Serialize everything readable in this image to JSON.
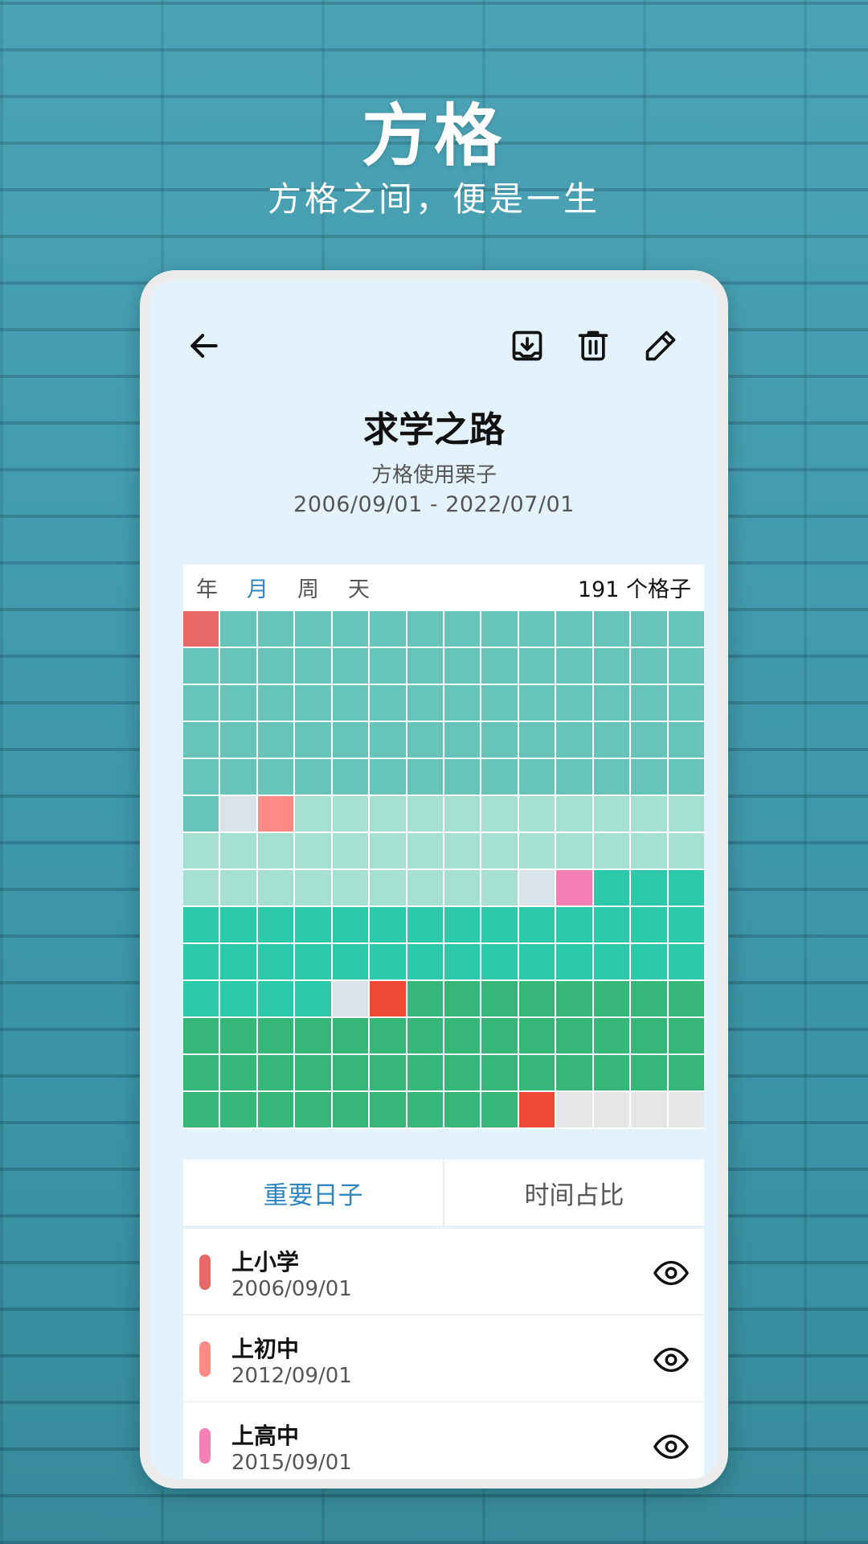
{
  "hero": {
    "title": "方格",
    "subtitle": "方格之间，便是一生"
  },
  "toolbar": {
    "back_icon": "arrow-left-icon",
    "download_icon": "download-tray-icon",
    "delete_icon": "trash-icon",
    "edit_icon": "pencil-icon"
  },
  "goal": {
    "title": "求学之路",
    "subtitle": "方格使用栗子",
    "range": "2006/09/01 - 2022/07/01"
  },
  "grid": {
    "unit_tabs": [
      "年",
      "月",
      "周",
      "天"
    ],
    "active_unit": 1,
    "count_text": "191 个格子",
    "columns": 14,
    "rows": 14,
    "colors": {
      "primary": "#67c4b9",
      "middle": "#a5e0d1",
      "high": "#2cc9ab",
      "college": "#37b679",
      "empty": "#e6e6e6",
      "marker_primary": "#e86767",
      "marker_middle": "#fd8a85",
      "marker_high": "#f580b5",
      "marker_end": "#ee4935",
      "gap": "#d8e4ea"
    },
    "segments": [
      {
        "color": "marker_primary",
        "count": 1
      },
      {
        "color": "primary",
        "count": 70
      },
      {
        "color": "gap",
        "count": 1
      },
      {
        "color": "marker_middle",
        "count": 1
      },
      {
        "color": "middle",
        "count": 34
      },
      {
        "color": "gap",
        "count": 1
      },
      {
        "color": "marker_high",
        "count": 1
      },
      {
        "color": "high",
        "count": 35
      },
      {
        "color": "gap",
        "count": 1
      },
      {
        "color": "marker_end",
        "count": 1
      },
      {
        "color": "college",
        "count": 45
      },
      {
        "color": "marker_end",
        "count": 1
      },
      {
        "color": "empty",
        "count": 4
      }
    ]
  },
  "tabs": [
    {
      "label": "重要日子",
      "active": true
    },
    {
      "label": "时间占比",
      "active": false
    }
  ],
  "events": [
    {
      "title": "上小学",
      "date": "2006/09/01",
      "color": "#e86767",
      "icon": "eye-icon"
    },
    {
      "title": "上初中",
      "date": "2012/09/01",
      "color": "#fd8a85",
      "icon": "eye-icon"
    },
    {
      "title": "上高中",
      "date": "2015/09/01",
      "color": "#f580b5",
      "icon": "eye-icon"
    }
  ]
}
